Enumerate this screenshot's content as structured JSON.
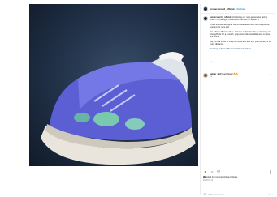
{
  "post": {
    "username": "runnersworld_official",
    "dot": "•",
    "follow_label": "Follow",
    "more_icon": "more-horizontal-icon"
  },
  "caption": {
    "username": "runnersworld_official",
    "lines": [
      "Introducing our next-generation racing shoe — lightweight, responsive and built for speed 🔥",
      "A new engineered upper with a breathable mesh and supportive overlays for race day.",
      "The Adizero Boston 10 ⚡ features Lightstrike Pro cushioning and EnergyRods for a smooth, propulsive ride. Available now in store and online.",
      "Tap the link in bio to shop the collection and find your perfect fit for every distance.",
      "#running #adizero #boston10 #runningshoes"
    ],
    "time": "1w"
  },
  "comment": {
    "username": "runner_girl",
    "text": "Need these! 🔥🔥",
    "time": "1w"
  },
  "actions": {
    "likes_text": "Liked by runnersworld and others",
    "date": "MARCH 14"
  },
  "add_comment": {
    "placeholder": "Add a comment...",
    "post_label": "Post"
  }
}
